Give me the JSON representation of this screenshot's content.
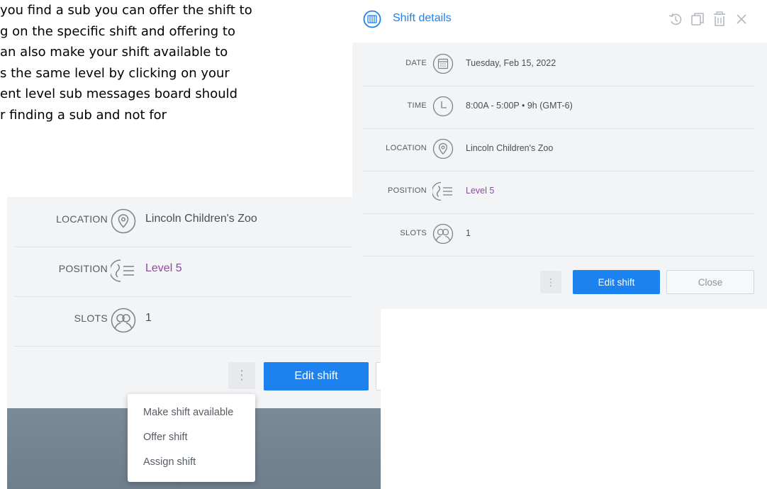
{
  "document": {
    "lines": [
      "you find a sub you can offer the shift to",
      "g on the specific shift and offering to",
      "an also make your shift available to",
      "s the same level by clicking on your",
      "ent level sub messages board should",
      "r finding a sub and not for"
    ]
  },
  "right_panel": {
    "title": "Shift details",
    "header_icons": [
      "shift-details-icon",
      "undo-icon",
      "duplicate-icon",
      "trash-icon",
      "close-icon"
    ],
    "rows": [
      {
        "label": "DATE",
        "icon": "calendar-icon",
        "value": "Tuesday, Feb 15, 2022"
      },
      {
        "label": "TIME",
        "icon": "clock-icon",
        "value": "8:00A - 5:00P • 9h (GMT-6)"
      },
      {
        "label": "LOCATION",
        "icon": "location-pin-icon",
        "value": "Lincoln Children's Zoo"
      },
      {
        "label": "POSITION",
        "icon": "position-icon",
        "value": "Level 5"
      },
      {
        "label": "SLOTS",
        "icon": "slots-icon",
        "value": "1"
      }
    ],
    "more_label": "⋮",
    "edit_label": "Edit shift",
    "close_label": "Close"
  },
  "left_panel": {
    "rows": [
      {
        "label": "LOCATION",
        "icon": "location-pin-icon",
        "value": "Lincoln Children's Zoo"
      },
      {
        "label": "POSITION",
        "icon": "position-icon",
        "value": "Level 5"
      },
      {
        "label": "SLOTS",
        "icon": "slots-icon",
        "value": "1"
      }
    ],
    "more_label": "⋮",
    "edit_label": "Edit shift"
  },
  "dropdown_menu": {
    "items": [
      "Make shift available",
      "Offer shift",
      "Assign shift"
    ]
  },
  "colors": {
    "accent": "#1b82f0",
    "position_value": "#8b4c9c",
    "panel_bg": "#f2f4f6"
  }
}
